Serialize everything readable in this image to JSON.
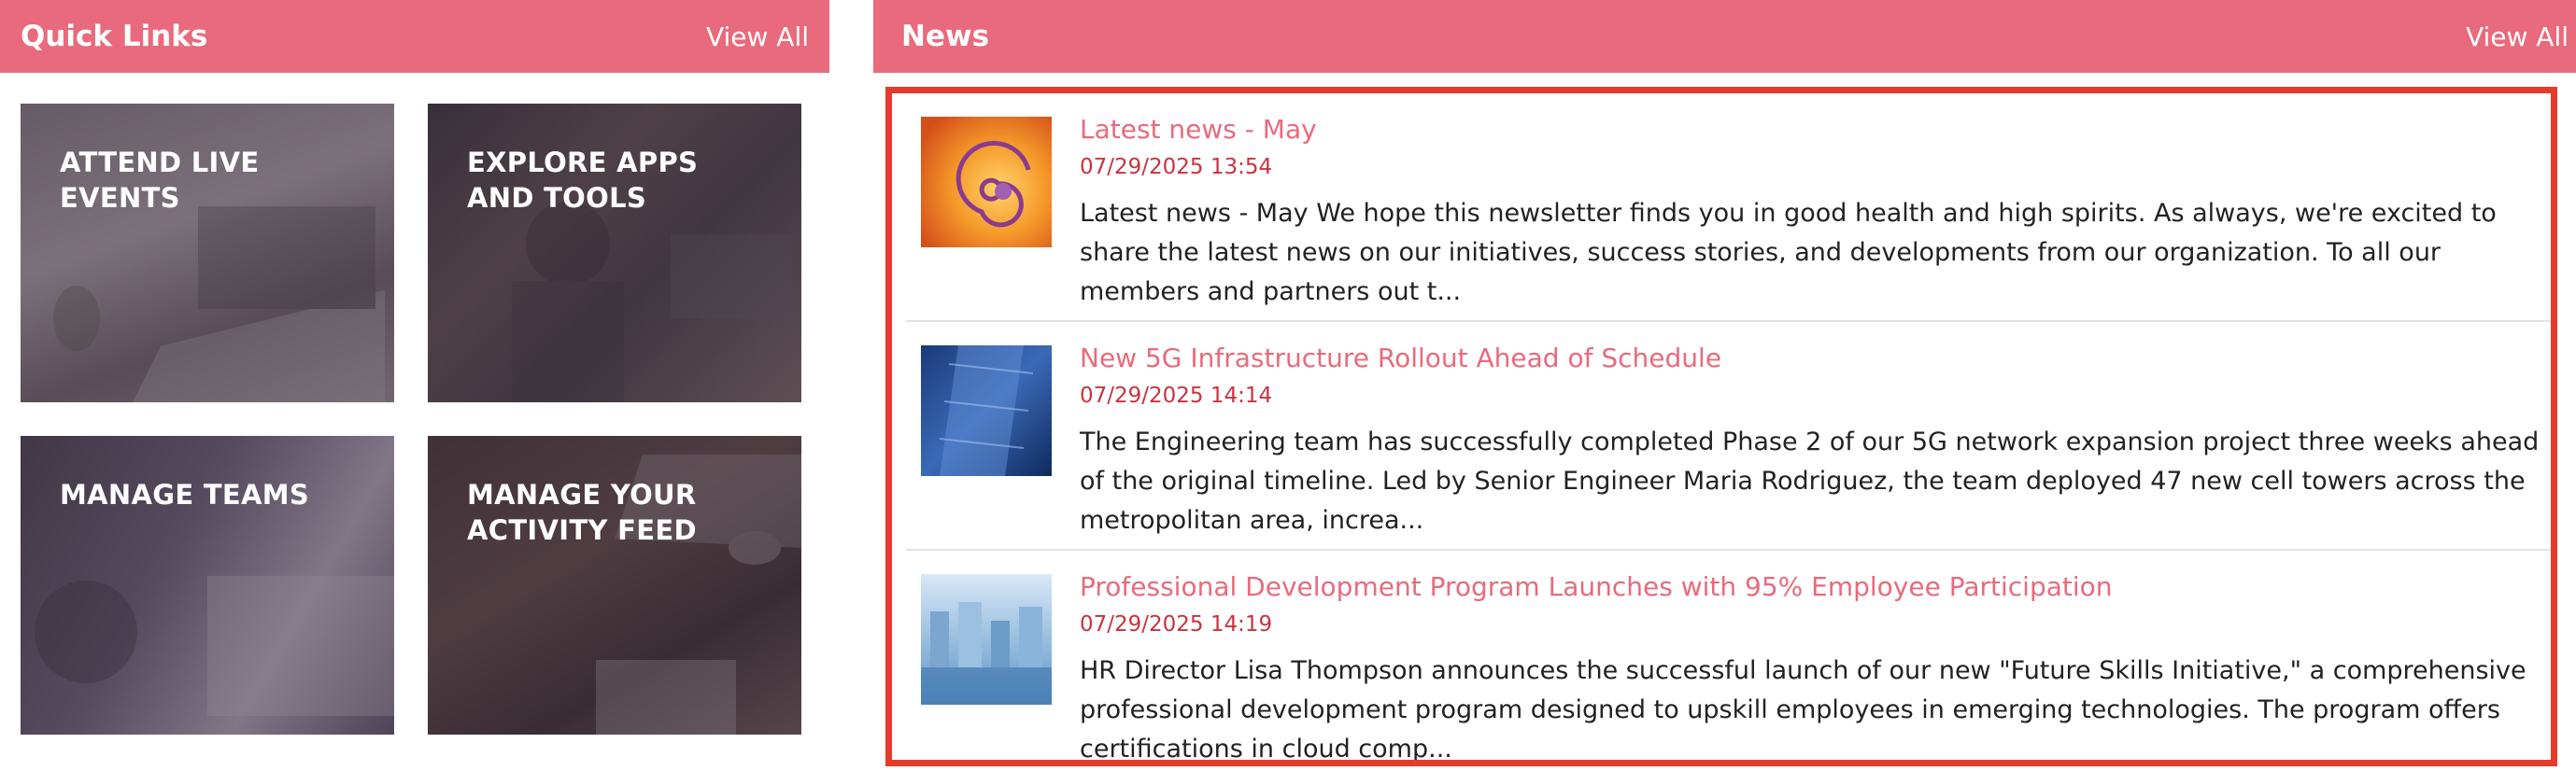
{
  "quick_links": {
    "title": "Quick Links",
    "view_all": "View All",
    "tiles": [
      {
        "label": "ATTEND LIVE EVENTS"
      },
      {
        "label": "EXPLORE APPS AND TOOLS"
      },
      {
        "label": "MANAGE TEAMS"
      },
      {
        "label": "MANAGE YOUR ACTIVITY FEED"
      }
    ]
  },
  "news": {
    "title": "News",
    "view_all": "View All",
    "items": [
      {
        "title": "Latest news - May",
        "date": "07/29/2025 13:54",
        "summary": "Latest news - May We hope this newsletter finds you in good health and high spirits. As always, we're excited to share the latest news on our initiatives, success stories, and developments from our organization. To all our members and partners out t..."
      },
      {
        "title": "New 5G Infrastructure Rollout Ahead of Schedule",
        "date": "07/29/2025 14:14",
        "summary": "The Engineering team has successfully completed Phase 2 of our 5G network expansion project three weeks ahead of the original timeline. Led by Senior Engineer Maria Rodriguez, the team deployed 47 new cell towers across the metropolitan area, increa..."
      },
      {
        "title": "Professional Development Program Launches with 95% Employee Participation",
        "date": "07/29/2025 14:19",
        "summary": "HR Director Lisa Thompson announces the successful launch of our new \"Future Skills Initiative,\" a comprehensive professional development program designed to upskill employees in emerging technologies. The program offers certifications in cloud comp..."
      }
    ]
  },
  "colors": {
    "header_bg": "#e96a7c",
    "news_title": "#e96a7c",
    "news_date": "#c8333f",
    "highlight_border": "#e33c2c"
  }
}
